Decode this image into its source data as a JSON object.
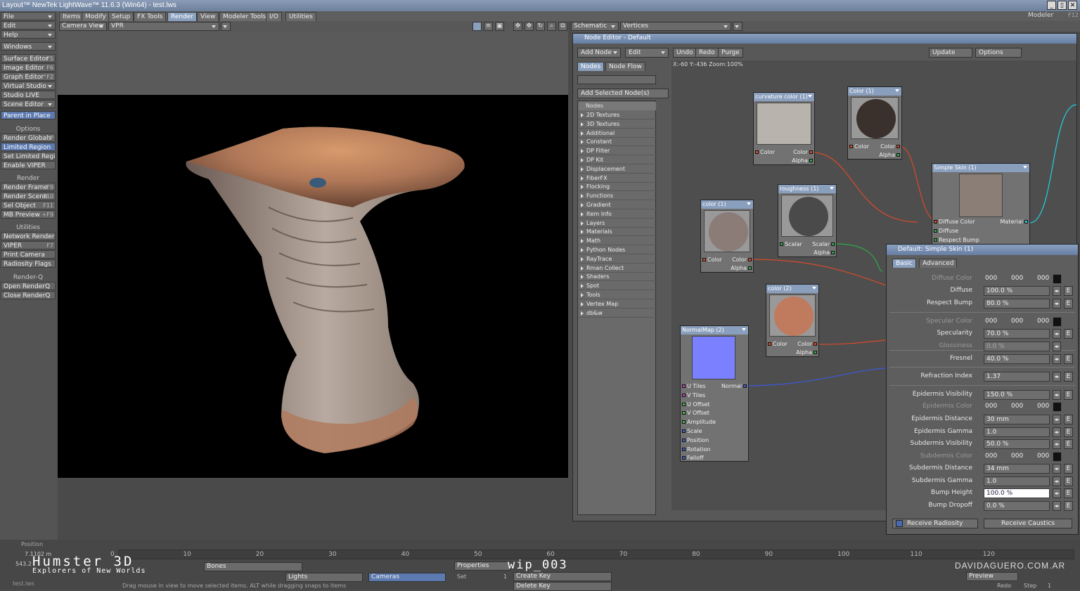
{
  "window": {
    "title": "Layout™ NewTek LightWave™ 11.6.3 (Win64) - test.lws",
    "controls": [
      "_",
      "▯",
      "✕"
    ]
  },
  "menu": {
    "tabs": [
      "Items",
      "Modify",
      "Setup",
      "FX Tools",
      "Render",
      "View",
      "Modeler Tools",
      "I/O",
      "Utilities"
    ],
    "active": "Render",
    "modeler": "Modeler",
    "modeler_key": "F12"
  },
  "sidebar": {
    "top": [
      {
        "label": "File"
      },
      {
        "label": "Edit"
      },
      {
        "label": "Help"
      }
    ],
    "windows": "Windows",
    "editors": [
      {
        "label": "Surface Editor",
        "key": "F5"
      },
      {
        "label": "Image Editor",
        "key": "F6"
      },
      {
        "label": "Graph Editor",
        "key": "^F2"
      },
      {
        "label": "Virtual Studio",
        "key": ""
      },
      {
        "label": "Studio LIVE",
        "key": ""
      },
      {
        "label": "Scene Editor",
        "key": ""
      }
    ],
    "parent": "Parent in Place",
    "options_header": "Options",
    "options": [
      {
        "label": "Render Globals",
        "key": "^P"
      },
      {
        "label": "Limited Region",
        "key": ""
      },
      {
        "label": "Set Limited Region",
        "key": ""
      },
      {
        "label": "Enable VIPER",
        "key": ""
      }
    ],
    "render_header": "Render",
    "render": [
      {
        "label": "Render Frame",
        "key": "F9"
      },
      {
        "label": "Render Scene",
        "key": "F10"
      },
      {
        "label": "Sel Object",
        "key": "F11"
      },
      {
        "label": "MB Preview",
        "key": "+F9"
      }
    ],
    "util_header": "Utilities",
    "util": [
      {
        "label": "Network Render",
        "key": ""
      },
      {
        "label": "VIPER",
        "key": "F7"
      },
      {
        "label": "Print Camera",
        "key": ""
      },
      {
        "label": "Radiosity Flags",
        "key": ""
      }
    ],
    "renderq_header": "Render-Q",
    "renderq": [
      {
        "label": "Open RenderQ"
      },
      {
        "label": "Close RenderQ"
      }
    ]
  },
  "viewport": {
    "view": "Camera View",
    "mode": "VPR"
  },
  "schematic": {
    "view": "Schematic",
    "mode": "Vertices"
  },
  "node_editor": {
    "title": "Node Editor - Default",
    "toolbar": [
      "Add Node",
      "Edit",
      "Undo",
      "Redo",
      "Purge",
      "Update",
      "Options"
    ],
    "tabs": [
      "Nodes",
      "Node Flow"
    ],
    "add_selected": "Add Selected Node(s)",
    "coords": "X:-60 Y:-436 Zoom:100%",
    "list_header": "Nodes",
    "categories": [
      "2D Textures",
      "3D Textures",
      "Additional",
      "Constant",
      "DP Filter",
      "DP Kit",
      "Displacement",
      "FiberFX",
      "Flocking",
      "Functions",
      "Gradient",
      "Item Info",
      "Layers",
      "Materials",
      "Math",
      "Python Nodes",
      "RayTrace",
      "Rman Collect",
      "Shaders",
      "Spot",
      "Tools",
      "Vertex Map",
      "db&w"
    ],
    "nodes": {
      "curv": {
        "title": "curvature color (1)",
        "in": "Color",
        "out": "Color",
        "out2": "Alpha",
        "preview": "#b9b3ad"
      },
      "color1": {
        "title": "Color (1)",
        "in": "Color",
        "out": "Color",
        "out2": "Alpha",
        "preview": "#3a302c"
      },
      "rough": {
        "title": "roughness (1)",
        "in": "Scalar",
        "out": "Scalar",
        "out2": "Alpha",
        "preview": "#4a4a4a"
      },
      "color1b": {
        "title": "color (1)",
        "in": "Color",
        "out": "Color",
        "out2": "Alpha",
        "preview": "#8c7c78"
      },
      "color2": {
        "title": "color (2)",
        "in": "Color",
        "out": "Color",
        "out2": "Alpha",
        "preview": "#c07a5e"
      },
      "normal": {
        "title": "NormalMap (2)",
        "out": "Normal",
        "inputs": [
          "U Tiles",
          "V Tiles",
          "U Offset",
          "V Offset",
          "Amplitude",
          "Scale",
          "Position",
          "Rotation",
          "Falloff"
        ]
      },
      "skin": {
        "title": "Simple Skin (1)",
        "in1": "Diffuse Color",
        "in2": "Diffuse",
        "in3": "Respect Bump",
        "out": "Material"
      }
    }
  },
  "props": {
    "title": "Default: Simple Skin (1)",
    "tabs": [
      "Basic",
      "Advanced"
    ],
    "rows": [
      {
        "label": "Diffuse Color",
        "type": "color",
        "v": [
          "000",
          "000",
          "000"
        ],
        "dim": true
      },
      {
        "label": "Diffuse",
        "value": "100.0 %"
      },
      {
        "label": "Respect Bump",
        "value": "80.0 %"
      },
      {
        "label": "Specular Color",
        "type": "color",
        "v": [
          "000",
          "000",
          "000"
        ],
        "dim": true
      },
      {
        "label": "Specularity",
        "value": "70.0 %"
      },
      {
        "label": "Glossiness",
        "value": "0.0 %",
        "dim": true
      },
      {
        "label": "Fresnel",
        "value": "40.0 %"
      },
      {
        "label": "Refraction Index",
        "value": "1.37"
      },
      {
        "label": "Epidermis Visibility",
        "value": "150.0 %"
      },
      {
        "label": "Epidermis Color",
        "type": "color",
        "v": [
          "000",
          "000",
          "000"
        ],
        "dim": true
      },
      {
        "label": "Epidermis Distance",
        "value": "30 mm"
      },
      {
        "label": "Epidermis Gamma",
        "value": "1.0"
      },
      {
        "label": "Subdermis Visibility",
        "value": "50.0 %"
      },
      {
        "label": "Subdermis Color",
        "type": "color",
        "v": [
          "000",
          "000",
          "000"
        ],
        "dim": true
      },
      {
        "label": "Subdermis Distance",
        "value": "34 mm"
      },
      {
        "label": "Subdermis Gamma",
        "value": "1.0"
      },
      {
        "label": "Bump Height",
        "value": "100.0 %",
        "sel": true
      },
      {
        "label": "Bump Dropoff",
        "value": "0.0 %"
      }
    ],
    "receive_radiosity": "Receive Radiosity",
    "receive_caustics": "Receive Caustics"
  },
  "timeline": {
    "position_label": "Position",
    "pos_value": "7.1102 m",
    "pos_value2": "543.2",
    "ticks": [
      "0",
      "10",
      "20",
      "30",
      "40",
      "50",
      "60",
      "70",
      "80",
      "90",
      "100",
      "110",
      "120"
    ],
    "fields": [
      "Bones",
      "Lights",
      "Cameras",
      "Properties",
      "Set",
      "Create Key",
      "Delete Key",
      "Preview",
      "Redo",
      "Step"
    ],
    "set_value": "1",
    "step_value": "1",
    "status": "Drag mouse in view to move selected items. ALT while dragging snaps to items",
    "scene_file": "test.lws"
  },
  "overlay": {
    "brand": "Humster 3D",
    "tagline": "Explorers of New Worlds",
    "wip": "wip_003",
    "site": "DAVIDAGUERO.COM.AR"
  },
  "colors": {
    "accent": "#5c7ab0",
    "title": "#7a8fad",
    "red_wire": "#d84a2a",
    "green_wire": "#2ea84a",
    "blue_wire": "#3a5ad8",
    "cyan_wire": "#20d0e0"
  }
}
